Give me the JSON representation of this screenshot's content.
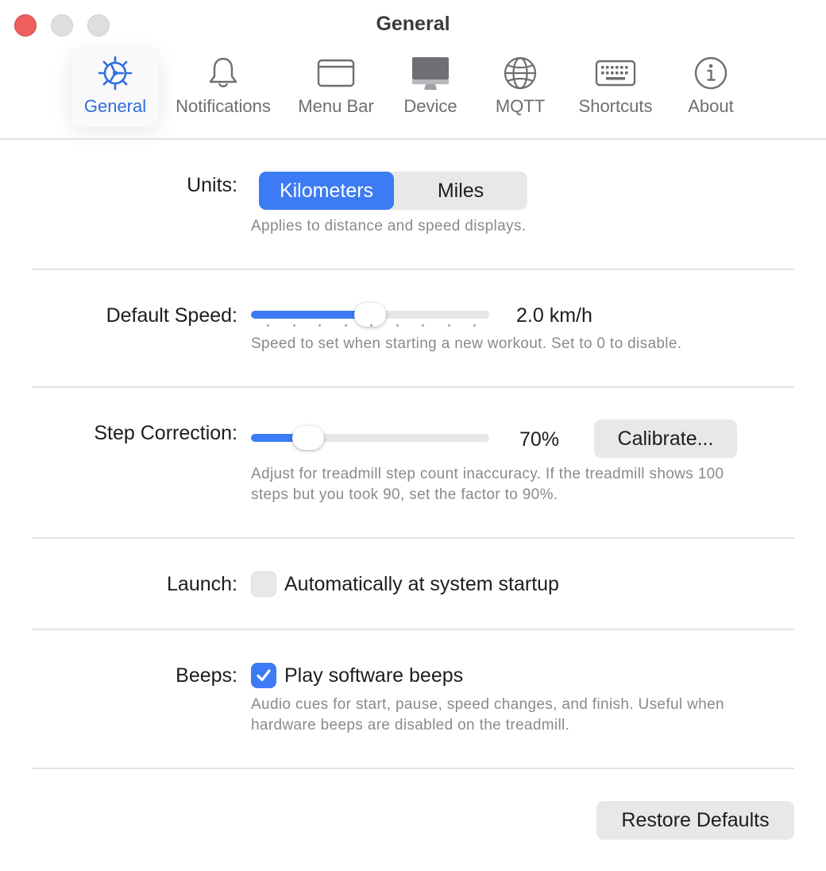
{
  "window": {
    "title": "General"
  },
  "toolbar": {
    "tabs": [
      {
        "label": "General",
        "icon": "gear-icon",
        "active": true
      },
      {
        "label": "Notifications",
        "icon": "bell-icon",
        "active": false
      },
      {
        "label": "Menu Bar",
        "icon": "menu-bar-icon",
        "active": false
      },
      {
        "label": "Device",
        "icon": "monitor-icon",
        "active": false
      },
      {
        "label": "MQTT",
        "icon": "globe-icon",
        "active": false
      },
      {
        "label": "Shortcuts",
        "icon": "keyboard-icon",
        "active": false
      },
      {
        "label": "About",
        "icon": "info-icon",
        "active": false
      }
    ]
  },
  "settings": {
    "units": {
      "label": "Units:",
      "options": [
        "Kilometers",
        "Miles"
      ],
      "selected": "Kilometers",
      "help": "Applies to distance and speed displays."
    },
    "default_speed": {
      "label": "Default Speed:",
      "value_text": "2.0 km/h",
      "slider_fraction": 0.5,
      "help": "Speed to set when starting a new workout. Set to 0 to disable."
    },
    "step_correction": {
      "label": "Step Correction:",
      "value_text": "70%",
      "slider_fraction": 0.24,
      "button_label": "Calibrate...",
      "help_line1": "Adjust for treadmill step count inaccuracy. If the treadmill shows 100",
      "help_line2": "steps but you took 90, set the factor to 90%."
    },
    "launch": {
      "label": "Launch:",
      "checkbox_label": "Automatically at system startup",
      "checked": false
    },
    "beeps": {
      "label": "Beeps:",
      "checkbox_label": "Play software beeps",
      "checked": true,
      "help_line1": "Audio cues for start, pause, speed changes, and finish. Useful when",
      "help_line2": "hardware beeps are disabled on the treadmill."
    }
  },
  "footer": {
    "restore_label": "Restore Defaults"
  },
  "colors": {
    "accent": "#3d7bf4",
    "close": "#ec5f5e",
    "active_tab_label": "#2f6ee0"
  }
}
